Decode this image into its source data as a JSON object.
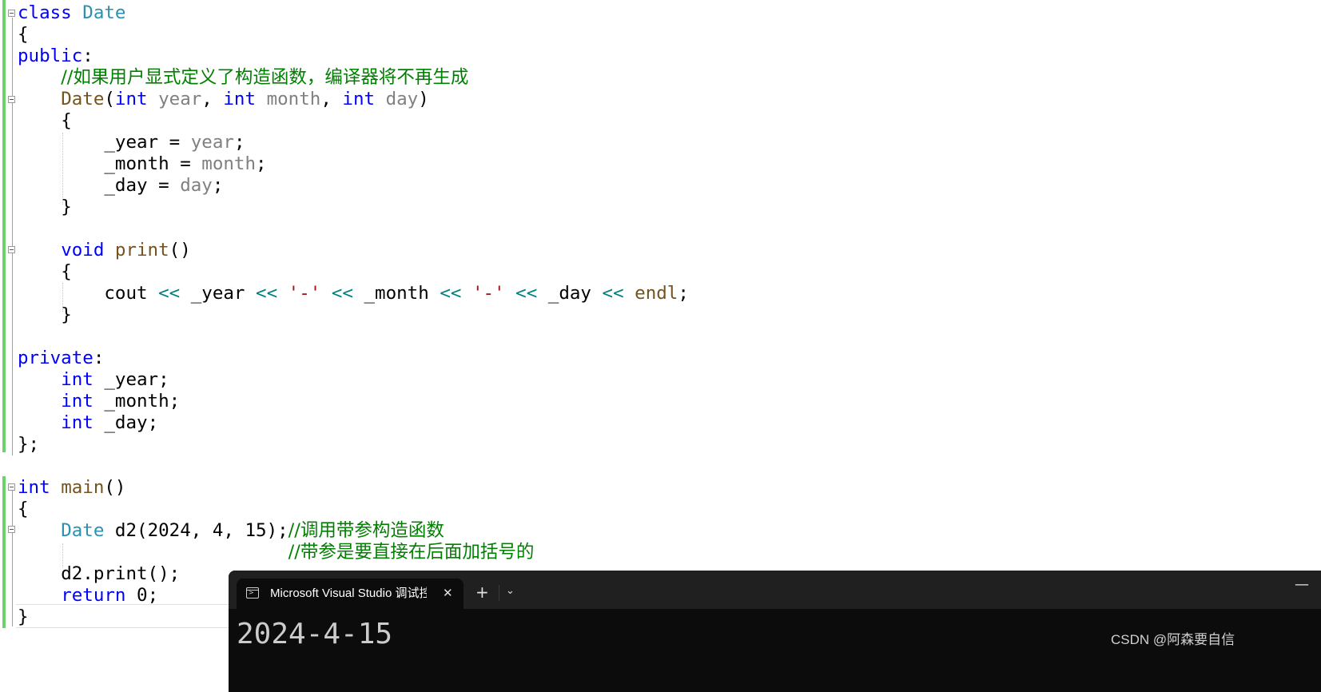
{
  "editor": {
    "tokens": {
      "kw_class": "class",
      "type_date": "Date",
      "lbrace": "{",
      "rbrace": "}",
      "rbrace_semi": "};",
      "kw_public": "public",
      "kw_private": "private",
      "colon": ":",
      "comment_ctor": "//如果用户显式定义了构造函数，编译器将不再生成",
      "fn_date": "Date",
      "lparen": "(",
      "rparen": ")",
      "comma": ", ",
      "kw_int": "int",
      "param_year": "year",
      "param_month": "month",
      "param_day": "day",
      "field_year": "_year",
      "field_month": "_month",
      "field_day": "_day",
      "assign": " = ",
      "semi": ";",
      "kw_void": "void",
      "fn_print": "print",
      "parens": "()",
      "var_cout": "cout",
      "op_shl": "<<",
      "str_dash": "'-'",
      "fn_endl": "endl",
      "fn_main": "main",
      "var_d2": "d2",
      "num_2024": "2024",
      "num_4": "4",
      "num_15": "15",
      "rparen_semi": ");",
      "comment_call": "//调用带参构造函数",
      "comment_parens": "//带参是要直接在后面加括号的",
      "dot": ".",
      "print_call": "print();",
      "kw_return": "return",
      "num_0": "0"
    }
  },
  "console": {
    "tab_title": "Microsoft Visual Studio 调试控制台",
    "tab_icon": "terminal-icon",
    "close_glyph": "✕",
    "new_tab_glyph": "+",
    "dropdown_glyph": "⌄",
    "minimize_glyph": "—",
    "output": "2024-4-15"
  },
  "watermark": "CSDN @阿森要自信",
  "colors": {
    "keyword": "#0000ff",
    "type": "#2b91af",
    "function": "#74531f",
    "parameter": "#808080",
    "comment": "#008000",
    "string": "#a31515",
    "operator": "#008080",
    "change_bar": "#6ad36a",
    "console_bg": "#0c0c0c",
    "console_titlebar": "#202020"
  }
}
